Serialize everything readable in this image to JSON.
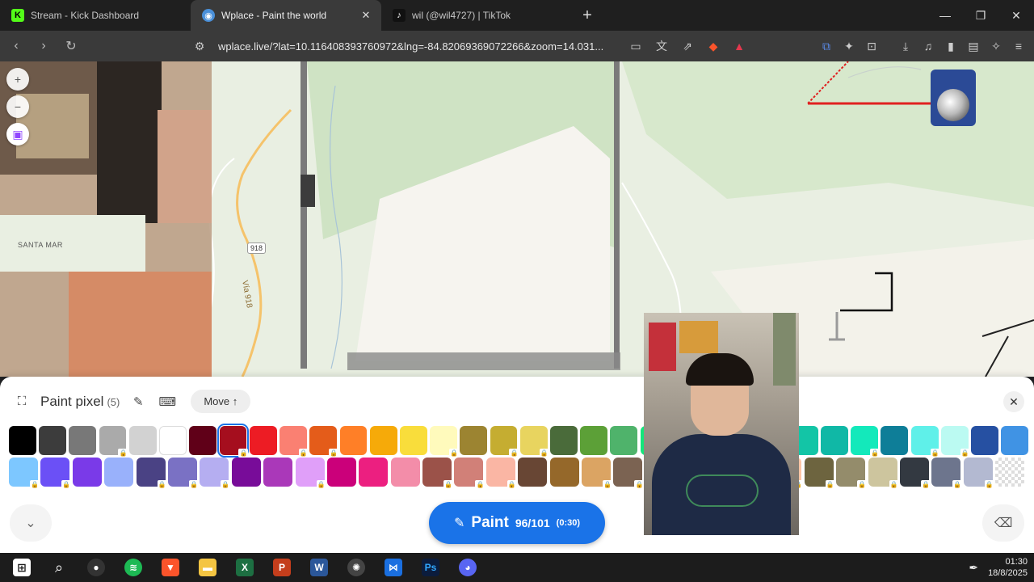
{
  "tabs": [
    {
      "label": "Stream - Kick Dashboard",
      "favicon": "K",
      "color": "#53fc18"
    },
    {
      "label": "Wplace - Paint the world",
      "favicon": "◉",
      "color": "#4a90d9"
    },
    {
      "label": "wil (@wil4727) | TikTok",
      "favicon": "♪",
      "color": "#111111"
    }
  ],
  "address_bar": {
    "url": "wplace.live/?lat=10.116408393760972&lng=-84.82069369072266&zoom=14.031..."
  },
  "map": {
    "labels": {
      "town": "SANTA MAR",
      "route": "918",
      "road": "Vía 918"
    }
  },
  "panel": {
    "title": "Paint pixel",
    "count": "(5)",
    "move_label": "Move ↑",
    "paint_label": "Paint",
    "paint_count": "96/101",
    "paint_time": "(0:30)"
  },
  "palette": {
    "row1": [
      {
        "color": "#000000",
        "locked": false
      },
      {
        "color": "#3c3c3c",
        "locked": false
      },
      {
        "color": "#787878",
        "locked": false
      },
      {
        "color": "#aaaaaa",
        "locked": true
      },
      {
        "color": "#d2d2d2",
        "locked": false
      },
      {
        "color": "#ffffff",
        "locked": false
      },
      {
        "color": "#600018",
        "locked": false
      },
      {
        "color": "#a50e1e",
        "locked": true,
        "selected": true
      },
      {
        "color": "#ed1c24",
        "locked": false
      },
      {
        "color": "#fa8072",
        "locked": true
      },
      {
        "color": "#e45c1a",
        "locked": true
      },
      {
        "color": "#ff7f27",
        "locked": false
      },
      {
        "color": "#f6aa09",
        "locked": false
      },
      {
        "color": "#f9dd3b",
        "locked": false
      },
      {
        "color": "#fffabc",
        "locked": true
      },
      {
        "color": "#9c8431",
        "locked": false
      },
      {
        "color": "#c5ad31",
        "locked": true
      },
      {
        "color": "#e8d45f",
        "locked": true
      },
      {
        "color": "#4a6b3a",
        "locked": false
      },
      {
        "color": "#5ca037",
        "locked": false
      },
      {
        "color": "#4fb36b",
        "locked": false
      },
      {
        "color": "#13e67b",
        "locked": false
      },
      {
        "color": "#0eb968",
        "locked": false
      },
      {
        "color": "#10ae9d",
        "locked": false
      },
      {
        "color": "#13e1be",
        "locked": false
      },
      {
        "color": "#0c816e",
        "locked": false
      },
      {
        "color": "#13c5a6",
        "locked": false
      },
      {
        "color": "#10b8a6",
        "locked": false
      },
      {
        "color": "#13e9bb",
        "locked": true
      },
      {
        "color": "#0e7e98",
        "locked": false
      },
      {
        "color": "#5ff0e9",
        "locked": true
      },
      {
        "color": "#bbfaf2",
        "locked": true
      },
      {
        "color": "#2650a2",
        "locked": false
      },
      {
        "color": "#4093e4",
        "locked": false
      }
    ],
    "row2": [
      {
        "color": "#7dc7ff",
        "locked": true
      },
      {
        "color": "#6b50f6",
        "locked": true
      },
      {
        "color": "#7a3ae8",
        "locked": false
      },
      {
        "color": "#99b1fb",
        "locked": false
      },
      {
        "color": "#4a4284",
        "locked": true
      },
      {
        "color": "#7a71c4",
        "locked": true
      },
      {
        "color": "#b5aef1",
        "locked": true
      },
      {
        "color": "#780c99",
        "locked": false
      },
      {
        "color": "#aa38b9",
        "locked": false
      },
      {
        "color": "#e09ff9",
        "locked": true
      },
      {
        "color": "#cb007a",
        "locked": false
      },
      {
        "color": "#ec1f80",
        "locked": false
      },
      {
        "color": "#f38da9",
        "locked": false
      },
      {
        "color": "#9b5249",
        "locked": true
      },
      {
        "color": "#d18078",
        "locked": true
      },
      {
        "color": "#fab6a4",
        "locked": true
      },
      {
        "color": "#684634",
        "locked": false
      },
      {
        "color": "#95682a",
        "locked": false
      },
      {
        "color": "#dba463",
        "locked": true
      },
      {
        "color": "#7b6352",
        "locked": true
      },
      {
        "color": "#9c846b",
        "locked": true
      },
      {
        "color": "#d6b594",
        "locked": true
      },
      {
        "color": "#d18051",
        "locked": true
      },
      {
        "color": "#f8b277",
        "locked": true
      },
      {
        "color": "#ffc5a5",
        "locked": true
      },
      {
        "color": "#6d643f",
        "locked": true
      },
      {
        "color": "#948c6b",
        "locked": true
      },
      {
        "color": "#cdc59e",
        "locked": true
      },
      {
        "color": "#333941",
        "locked": true
      },
      {
        "color": "#6d758d",
        "locked": true
      },
      {
        "color": "#b3b9d1",
        "locked": true
      },
      {
        "color": "transparent",
        "locked": false
      }
    ]
  },
  "taskbar": {
    "time": "01:30",
    "date": "18/8/2025"
  }
}
